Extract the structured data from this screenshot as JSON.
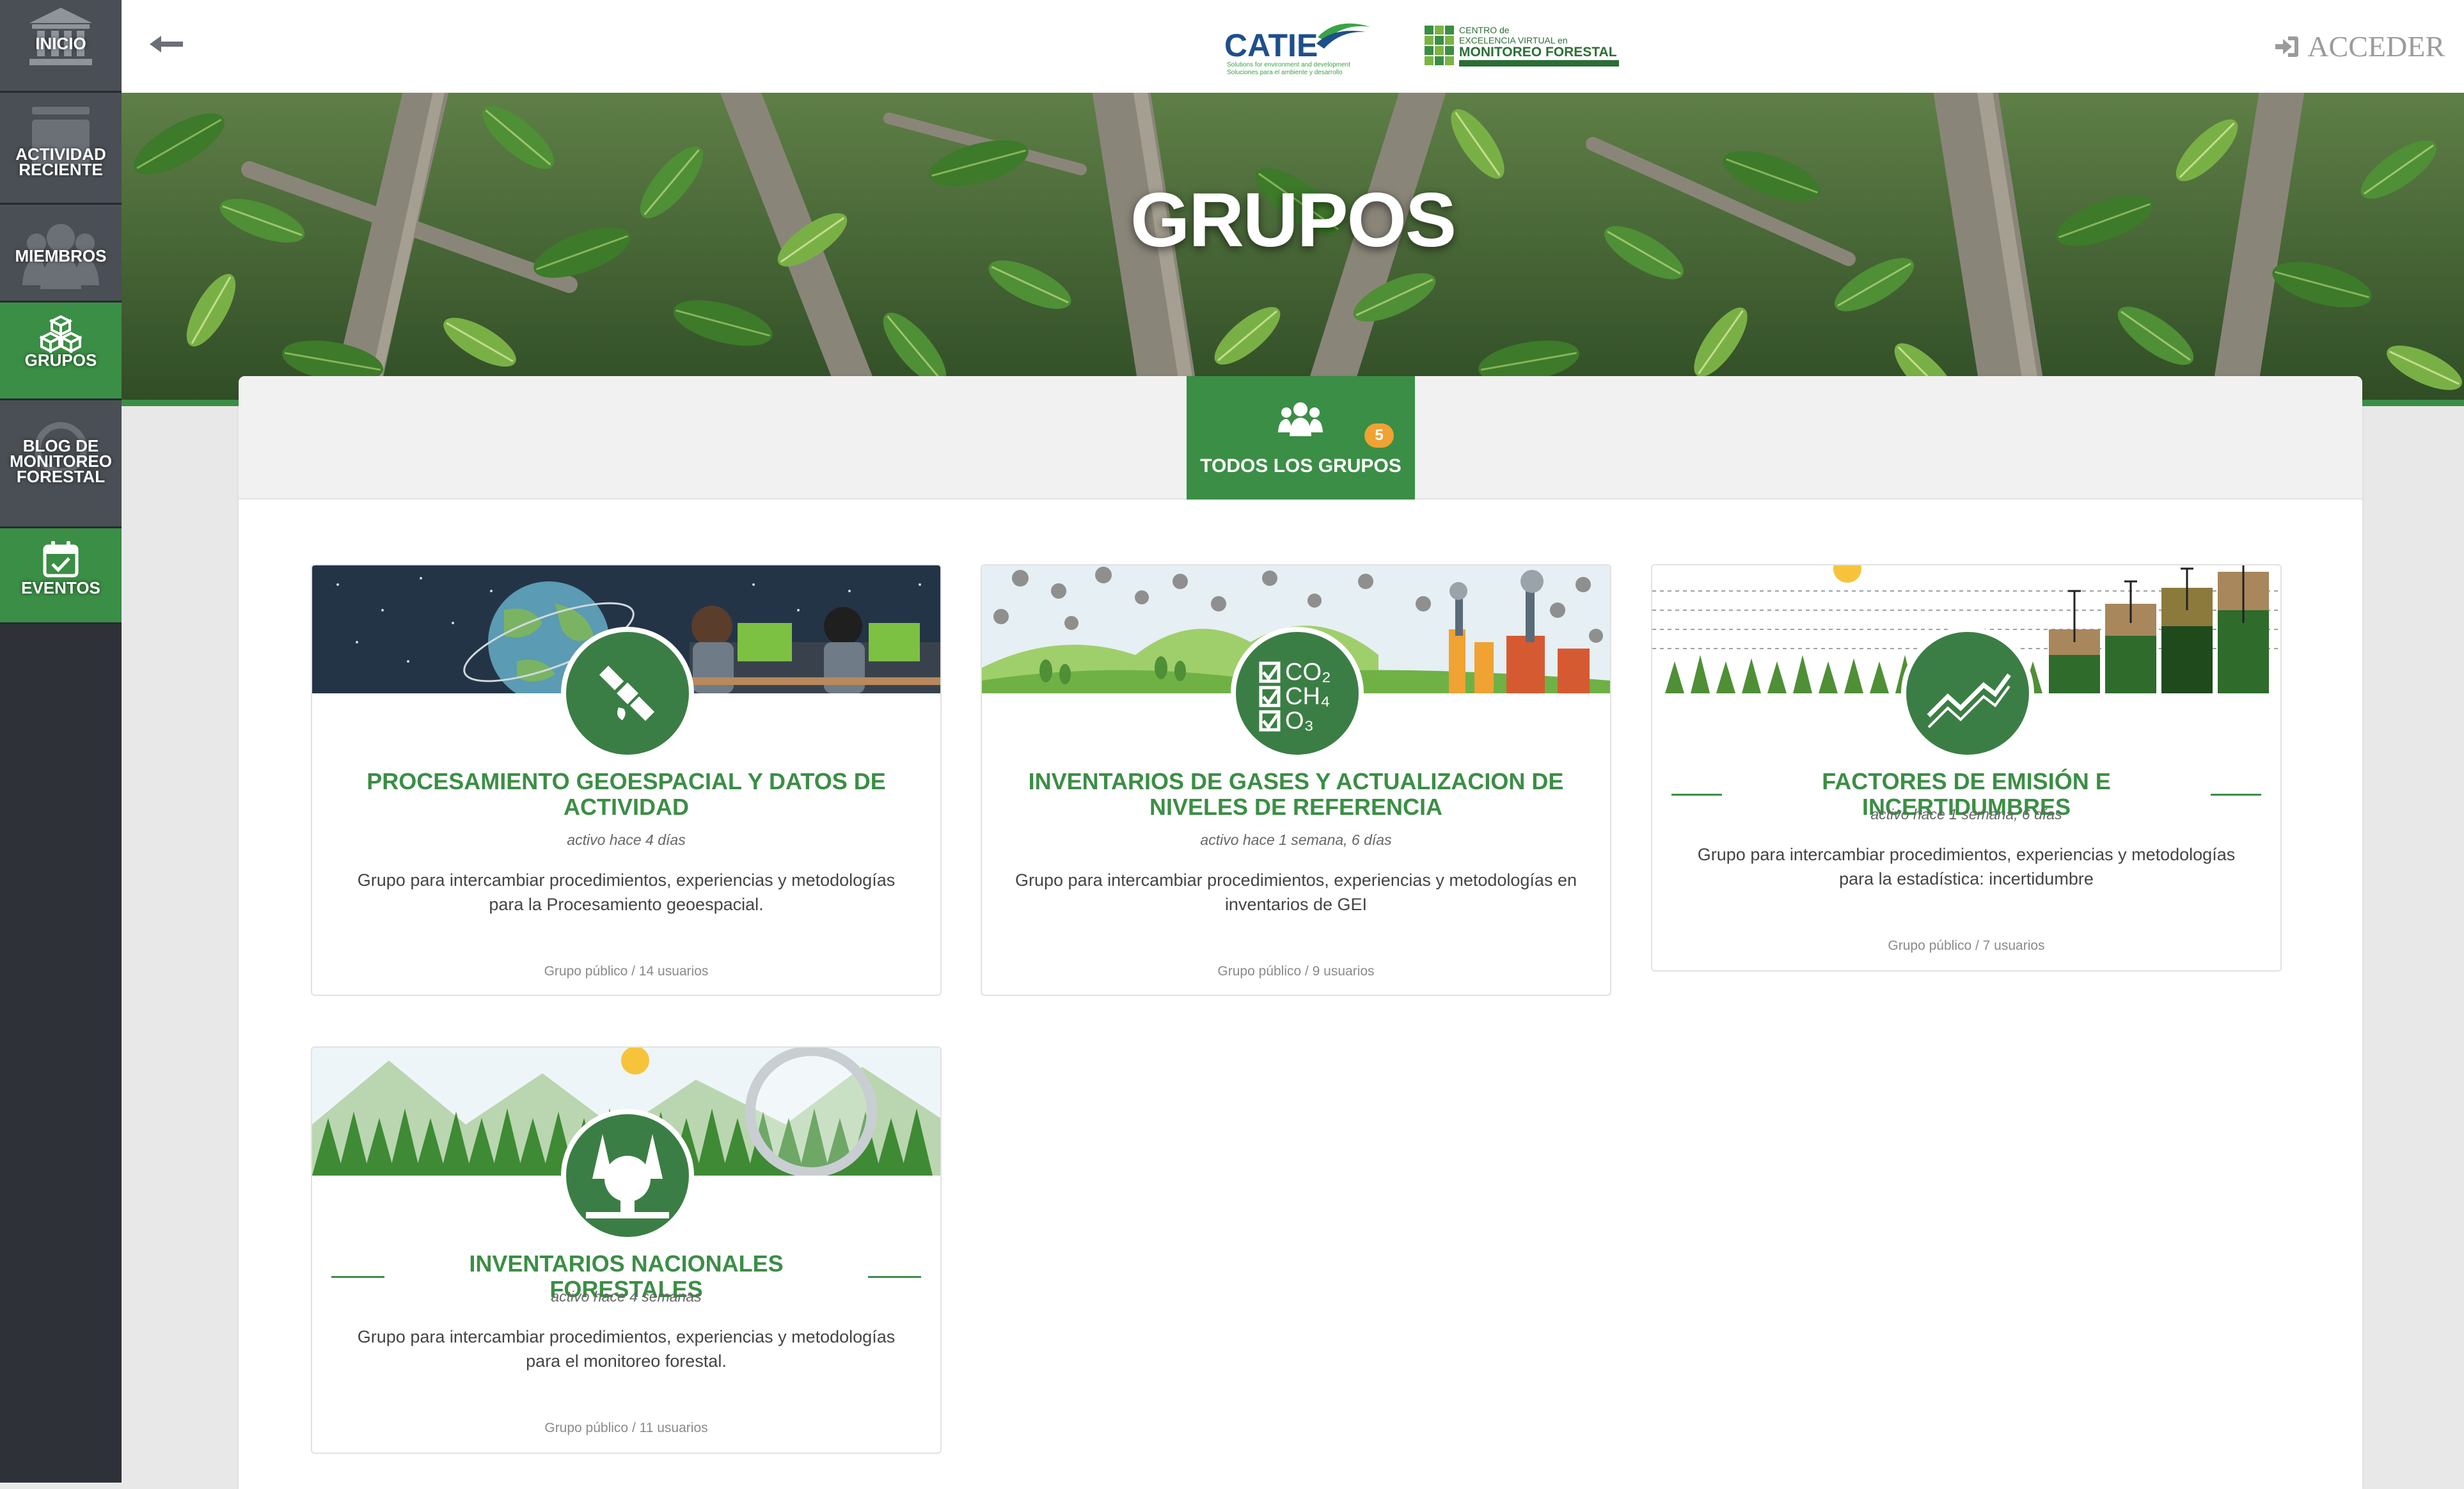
{
  "sidebar": {
    "items": [
      {
        "label": "INICIO"
      },
      {
        "label": "ACTIVIDAD RECIENTE"
      },
      {
        "label": "MIEMBROS"
      },
      {
        "label": "GRUPOS"
      },
      {
        "label": "BLOG DE MONITOREO FORESTAL"
      },
      {
        "label": "EVENTOS"
      }
    ]
  },
  "topbar": {
    "logo_catie": "CATIE",
    "logo_catie_tagline1": "Solutions for environment and development",
    "logo_catie_tagline2": "Soluciones para el ambiente y desarrollo",
    "logo_cevmf_line1": "CENTRO de",
    "logo_cevmf_line2": "EXCELENCIA VIRTUAL en",
    "logo_cevmf_line3": "MONITOREO FORESTAL",
    "login_label": "ACCEDER"
  },
  "hero": {
    "title": "GRUPOS"
  },
  "tabs": {
    "all_label": "TODOS LOS GRUPOS",
    "all_count": "5"
  },
  "groups": [
    {
      "title": "PROCESAMIENTO GEOESPACIAL Y DATOS DE ACTIVIDAD",
      "activity": "activo hace 4 días",
      "description": "Grupo para intercambiar procedimientos, experiencias y metodologías para la Procesamiento geoespacial.",
      "meta": "Grupo público / 14 usuarios"
    },
    {
      "title": "INVENTARIOS DE GASES Y ACTUALIZACION DE NIVELES DE REFERENCIA",
      "activity": "activo hace 1 semana, 6 días",
      "description": "Grupo para intercambiar procedimientos, experiencias y metodologías en inventarios de GEI",
      "meta": "Grupo público / 9 usuarios",
      "avatar_text": [
        "CO₂",
        "CH₄",
        "O₃"
      ]
    },
    {
      "title": "FACTORES DE EMISIÓN E INCERTIDUMBRES",
      "activity": "activo hace 1 semana, 6 días",
      "description": "Grupo para intercambiar procedimientos, experiencias y metodologías para la estadística: incertidumbre",
      "meta": "Grupo público / 7 usuarios"
    },
    {
      "title": "INVENTARIOS NACIONALES FORESTALES",
      "activity": "activo hace 4 semanas",
      "description": "Grupo para intercambiar procedimientos, experiencias y metodologías para el monitoreo forestal.",
      "meta": "Grupo público / 11 usuarios"
    }
  ],
  "colors": {
    "brand_green": "#3b8e45",
    "sidebar_dark": "#2e3238",
    "badge_orange": "#f0a233"
  },
  "icons": {
    "back": "arrow-left-icon",
    "login": "sign-in-icon",
    "inicio": "bank-icon",
    "actividad": "activity-icon",
    "miembros": "users-icon",
    "grupos": "cubes-icon",
    "blog": "blog-icon",
    "eventos": "calendar-check-icon",
    "tab_all": "users-icon"
  }
}
